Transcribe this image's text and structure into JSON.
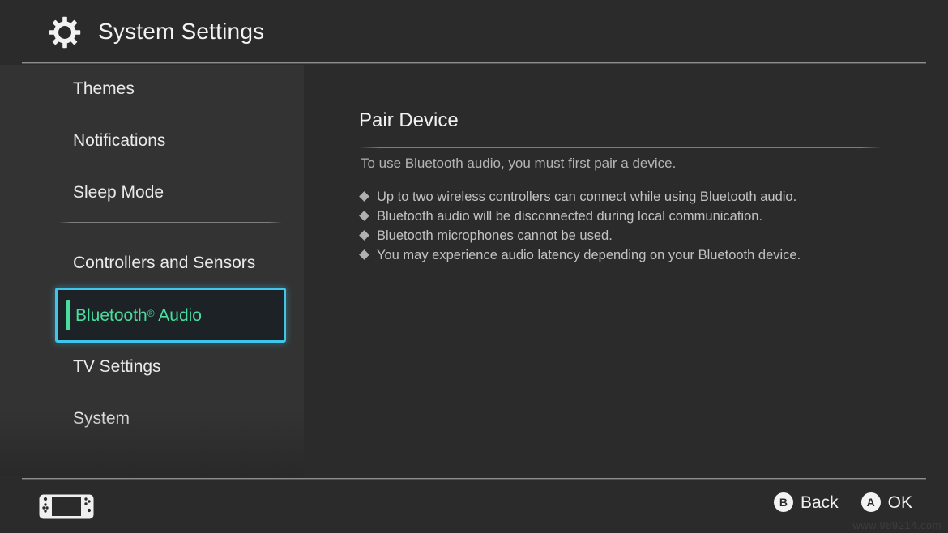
{
  "header": {
    "title": "System Settings",
    "icon": "gear-icon"
  },
  "sidebar": {
    "items": [
      {
        "label": "Themes",
        "selected": false
      },
      {
        "label": "Notifications",
        "selected": false
      },
      {
        "label": "Sleep Mode",
        "selected": false
      },
      {
        "label": "Controllers and Sensors",
        "selected": false
      },
      {
        "label_main": "Bluetooth",
        "label_mark": "®",
        "label_tail": " Audio",
        "label": "Bluetooth® Audio",
        "selected": true
      },
      {
        "label": "TV Settings",
        "selected": false
      },
      {
        "label": "System",
        "selected": false
      }
    ]
  },
  "main": {
    "title": "Pair Device",
    "intro": "To use Bluetooth audio, you must first pair a device.",
    "notes": [
      "Up to two wireless controllers can connect while using Bluetooth audio.",
      "Bluetooth audio will be disconnected during local communication.",
      "Bluetooth microphones cannot be used.",
      "You may experience audio latency depending on your Bluetooth device."
    ]
  },
  "footer": {
    "console_icon": "nintendo-switch-console-icon",
    "prompts": [
      {
        "badge": "B",
        "label": "Back"
      },
      {
        "badge": "A",
        "label": "OK"
      }
    ]
  },
  "watermark": "www.989214.com",
  "colors": {
    "background": "#2b2b2b",
    "sidebar": "#333333",
    "selection_border": "#3fc6ea",
    "selection_text": "#4ade9e",
    "selection_fill": "#1d2226",
    "primary_text": "#f2f2f2",
    "secondary_text": "#c2c2c2"
  }
}
